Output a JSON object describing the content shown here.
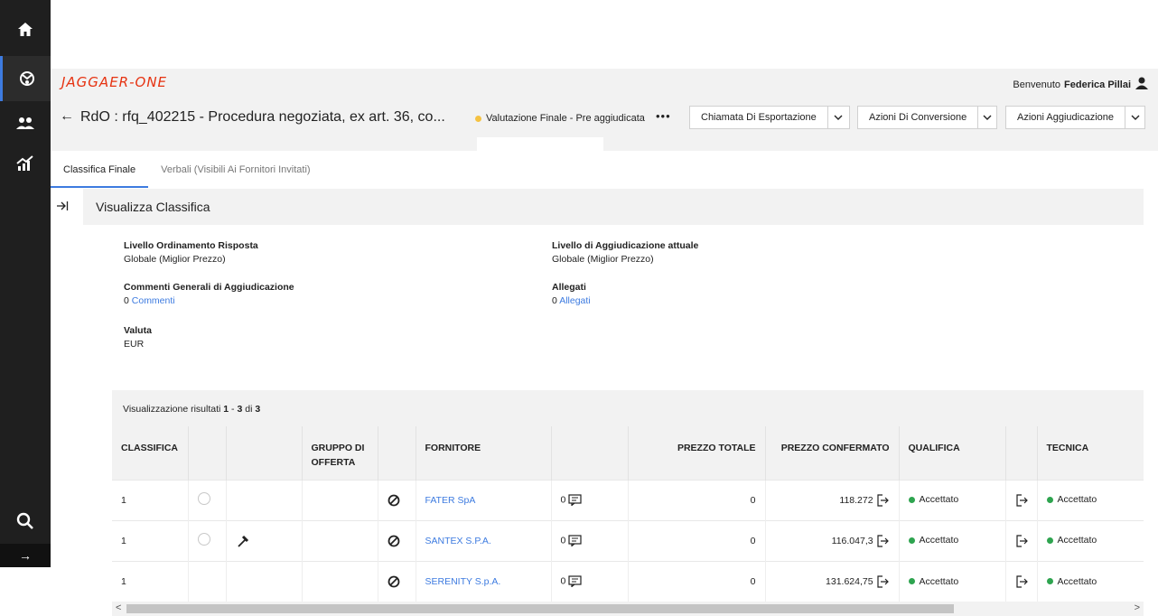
{
  "rail": {
    "items": [
      {
        "icon": "home-icon"
      },
      {
        "icon": "sourcing-icon"
      },
      {
        "icon": "suppliers-icon"
      },
      {
        "icon": "analytics-icon"
      }
    ],
    "search_icon": "search-icon",
    "expand_label": "→"
  },
  "header": {
    "logo": "JAGGAER-ONE",
    "welcome_prefix": "Benvenuto",
    "user_name": "Federica Pillai"
  },
  "titlebar": {
    "back": "←",
    "title": "RdO : rfq_402215 - Procedura negoziata, ex art. 36, co...",
    "status": "Valutazione Finale - Pre aggiudicata",
    "more": "•••",
    "buttons": [
      {
        "label": "Chiamata Di Esportazione"
      },
      {
        "label": "Azioni Di Conversione"
      },
      {
        "label": "Azioni Aggiudicazione"
      }
    ],
    "accent": "#3d7be0",
    "status_color": "#f5c242"
  },
  "tabs": [
    {
      "label": "Classifica Finale"
    },
    {
      "label": "Verbali (Visibili Ai Fornitori Invitati)"
    }
  ],
  "panel": {
    "title": "Visualizza Classifica",
    "fields": {
      "ordinamento": {
        "label": "Livello Ordinamento Risposta",
        "value": "Globale (Miglior Prezzo)"
      },
      "aggiudicazione": {
        "label": "Livello di Aggiudicazione attuale",
        "value": "Globale (Miglior Prezzo)"
      },
      "commenti": {
        "label": "Commenti Generali di Aggiudicazione",
        "count": "0",
        "link": "Commenti"
      },
      "allegati": {
        "label": "Allegati",
        "count": "0",
        "link": "Allegati"
      },
      "valuta": {
        "label": "Valuta",
        "value": "EUR"
      }
    }
  },
  "results": {
    "prefix": "Visualizzazione risultati",
    "from": "1",
    "sep": "-",
    "to": "3",
    "of": "di",
    "total": "3"
  },
  "table": {
    "headers": {
      "classifica": "CLASSIFICA",
      "gruppo": "GRUPPO DI OFFERTA",
      "fornitore": "FORNITORE",
      "prezzo_totale": "PREZZO TOTALE",
      "prezzo_confermato": "PREZZO CONFERMATO",
      "qualifica": "QUALIFICA",
      "tecnica": "TECNICA"
    },
    "rows": [
      {
        "rank": "1",
        "radio": true,
        "hammer": false,
        "supplier": "FATER SpA",
        "messages": "0",
        "total": "0",
        "confirmed": "118.272",
        "qualifica": "Accettato",
        "tecnica": "Accettato"
      },
      {
        "rank": "1",
        "radio": true,
        "hammer": true,
        "supplier": "SANTEX S.P.A.",
        "messages": "0",
        "total": "0",
        "confirmed": "116.047,3",
        "qualifica": "Accettato",
        "tecnica": "Accettato"
      },
      {
        "rank": "1",
        "radio": false,
        "hammer": false,
        "supplier": "SERENITY S.p.A.",
        "messages": "0",
        "total": "0",
        "confirmed": "131.624,75",
        "qualifica": "Accettato",
        "tecnica": "Accettato"
      }
    ],
    "status_color": "#2ea44f"
  },
  "scroll": {
    "left": "<",
    "right": ">"
  }
}
